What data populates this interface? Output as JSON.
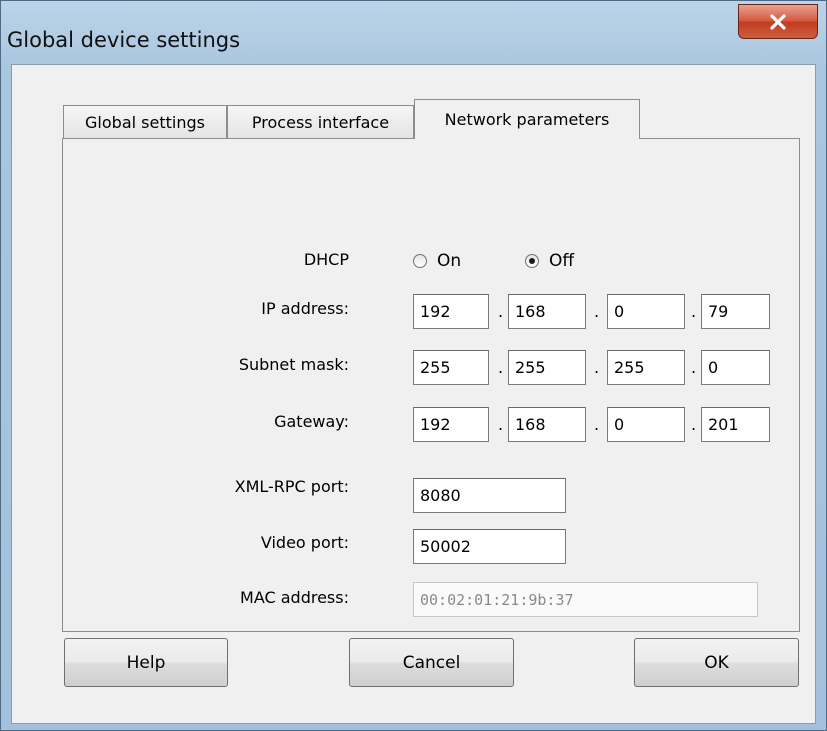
{
  "window": {
    "title": "Global device settings",
    "close_glyph": "✕"
  },
  "tabs": [
    {
      "label": "Global settings",
      "active": false
    },
    {
      "label": "Process interface",
      "active": false
    },
    {
      "label": "Network parameters",
      "active": true
    }
  ],
  "network": {
    "dhcp": {
      "label": "DHCP",
      "options": [
        {
          "label": "On",
          "selected": false
        },
        {
          "label": "Off",
          "selected": true
        }
      ]
    },
    "ip_address": {
      "label": "IP address:",
      "octets": [
        "192",
        "168",
        "0",
        "79"
      ]
    },
    "subnet_mask": {
      "label": "Subnet mask:",
      "octets": [
        "255",
        "255",
        "255",
        "0"
      ]
    },
    "gateway": {
      "label": "Gateway:",
      "octets": [
        "192",
        "168",
        "0",
        "201"
      ]
    },
    "xmlrpc_port": {
      "label": "XML-RPC port:",
      "value": "8080"
    },
    "video_port": {
      "label": "Video port:",
      "value": "50002"
    },
    "mac_address": {
      "label": "MAC address:",
      "value": "00:02:01:21:9b:37"
    },
    "octet_separator": "."
  },
  "buttons": {
    "help": "Help",
    "cancel": "Cancel",
    "ok": "OK"
  },
  "colors": {
    "close_button": "#c8452b",
    "client_bg": "#f0f0f0",
    "frame": "#a9c6df"
  }
}
